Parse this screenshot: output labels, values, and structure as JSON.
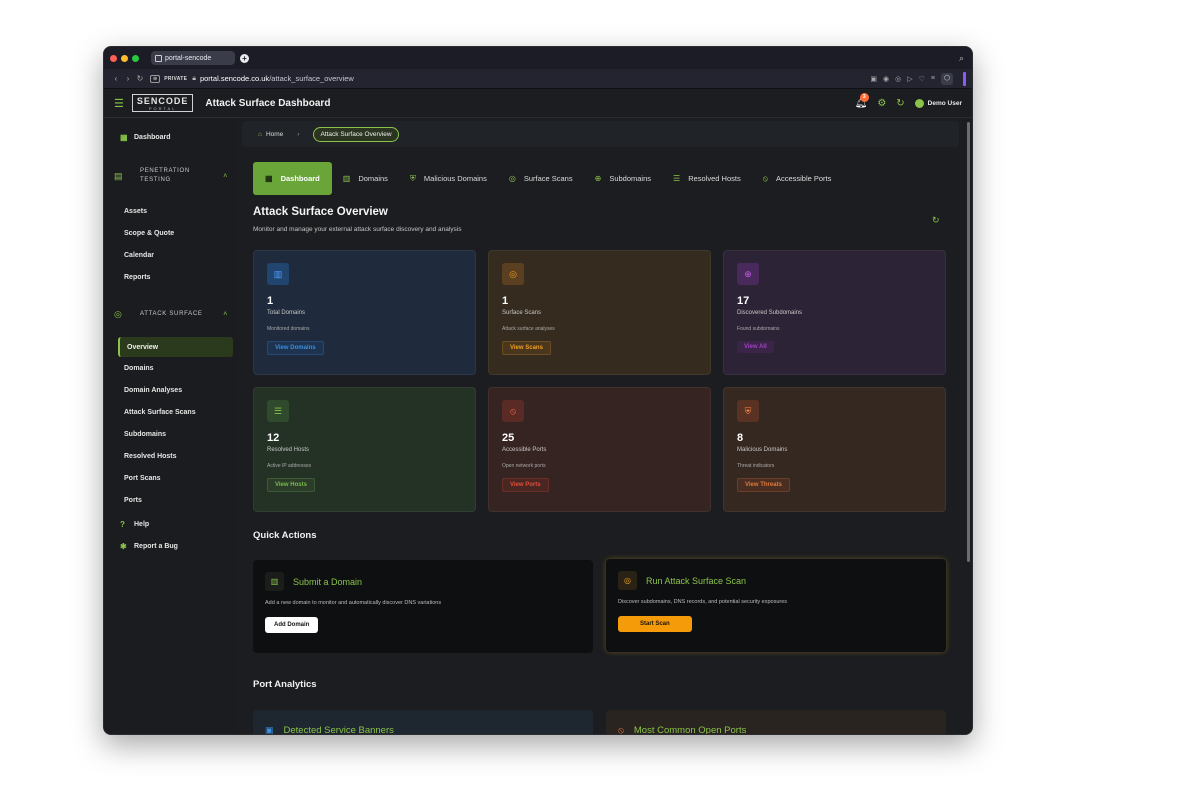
{
  "browser": {
    "tab_title": "portal-sencode",
    "new_tab": "+",
    "search_icon": "⌕",
    "private_badge": "⊕",
    "private_label": "PRIVATE",
    "url_domain": "portal.sencode.co.uk",
    "url_path": "/attack_surface_overview"
  },
  "header": {
    "logo_main": "SENCODE",
    "logo_sub": "PORTAL",
    "title": "Attack Surface Dashboard",
    "notifications": "3",
    "user": "Demo User"
  },
  "sidebar": {
    "dashboard": "Dashboard",
    "pen_section": "PENETRATION TESTING",
    "pen_items": [
      "Assets",
      "Scope & Quote",
      "Calendar",
      "Reports"
    ],
    "as_section": "ATTACK SURFACE",
    "as_items": [
      "Overview",
      "Domains",
      "Domain Analyses",
      "Attack Surface Scans",
      "Subdomains",
      "Resolved Hosts",
      "Port Scans",
      "Ports"
    ],
    "help": "Help",
    "report_bug": "Report a Bug"
  },
  "breadcrumb": {
    "home": "Home",
    "separator": "›",
    "current": "Attack Surface Overview"
  },
  "tabs": [
    {
      "label": "Dashboard",
      "icon": "dashboard-icon"
    },
    {
      "label": "Domains",
      "icon": "building-icon"
    },
    {
      "label": "Malicious Domains",
      "icon": "shield-icon"
    },
    {
      "label": "Surface Scans",
      "icon": "radar-icon"
    },
    {
      "label": "Subdomains",
      "icon": "globe-icon"
    },
    {
      "label": "Resolved Hosts",
      "icon": "list-icon"
    },
    {
      "label": "Accessible Ports",
      "icon": "signal-icon"
    }
  ],
  "page": {
    "title": "Attack Surface Overview",
    "subtitle": "Monitor and manage your external attack surface discovery and analysis"
  },
  "stats": [
    {
      "value": "1",
      "label": "Total Domains",
      "desc": "Monitored domains",
      "button": "View Domains",
      "color": "#3b8fe0"
    },
    {
      "value": "1",
      "label": "Surface Scans",
      "desc": "Attack surface analyses",
      "button": "View Scans",
      "color": "#f0a020"
    },
    {
      "value": "17",
      "label": "Discovered Subdomains",
      "desc": "Found subdomains",
      "button": "View All",
      "color": "#a040c0"
    },
    {
      "value": "12",
      "label": "Resolved Hosts",
      "desc": "Active IP addresses",
      "button": "View Hosts",
      "color": "#6aa53a"
    },
    {
      "value": "25",
      "label": "Accessible Ports",
      "desc": "Open network ports",
      "button": "View Ports",
      "color": "#e0503a"
    },
    {
      "value": "8",
      "label": "Malicious Domains",
      "desc": "Threat indicators",
      "button": "View Threats",
      "color": "#e07a3a"
    }
  ],
  "quick_actions": {
    "title": "Quick Actions",
    "submit": {
      "title": "Submit a Domain",
      "desc": "Add a new domain to monitor and automatically discover DNS variations",
      "button": "Add Domain"
    },
    "scan": {
      "title": "Run Attack Surface Scan",
      "desc": "Discover subdomains, DNS records, and potential security exposures",
      "button": "Start Scan"
    }
  },
  "port_analytics": {
    "title": "Port Analytics",
    "banners": "Detected Service Banners",
    "common_ports": "Most Common Open Ports"
  }
}
